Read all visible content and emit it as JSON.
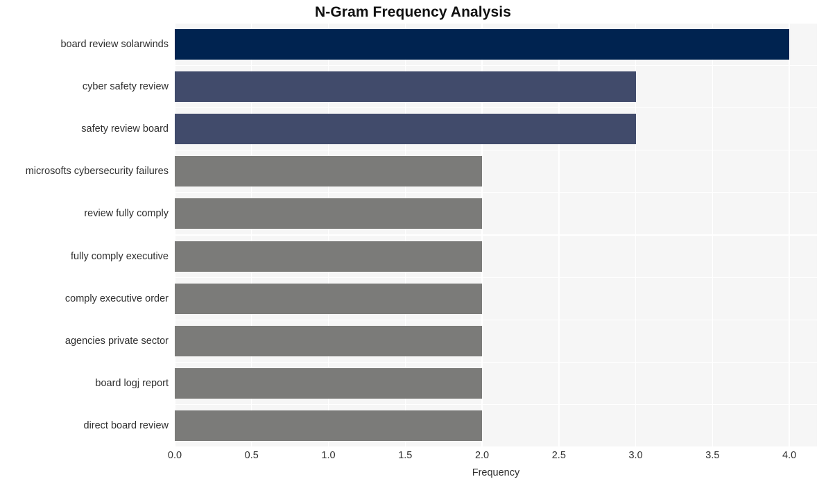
{
  "chart_data": {
    "type": "bar",
    "orientation": "horizontal",
    "title": "N-Gram Frequency Analysis",
    "xlabel": "Frequency",
    "ylabel": "",
    "xlim": [
      0,
      4.18
    ],
    "xticks": [
      "0.0",
      "0.5",
      "1.0",
      "1.5",
      "2.0",
      "2.5",
      "3.0",
      "3.5",
      "4.0"
    ],
    "xtick_values": [
      0,
      0.5,
      1,
      1.5,
      2,
      2.5,
      3,
      3.5,
      4
    ],
    "grid": true,
    "legend": "none",
    "categories": [
      "board review solarwinds",
      "cyber safety review",
      "safety review board",
      "microsofts cybersecurity failures",
      "review fully comply",
      "fully comply executive",
      "comply executive order",
      "agencies private sector",
      "board logj report",
      "direct board review"
    ],
    "values": [
      4,
      3,
      3,
      2,
      2,
      2,
      2,
      2,
      2,
      2
    ],
    "bar_colors": [
      "#002350",
      "#414b6b",
      "#414b6b",
      "#7b7b79",
      "#7b7b79",
      "#7b7b79",
      "#7b7b79",
      "#7b7b79",
      "#7b7b79",
      "#7b7b79"
    ],
    "plot_bgcolor": "#f6f6f6",
    "grid_color": "#ffffff",
    "figure_bgcolor": "#ffffff"
  }
}
